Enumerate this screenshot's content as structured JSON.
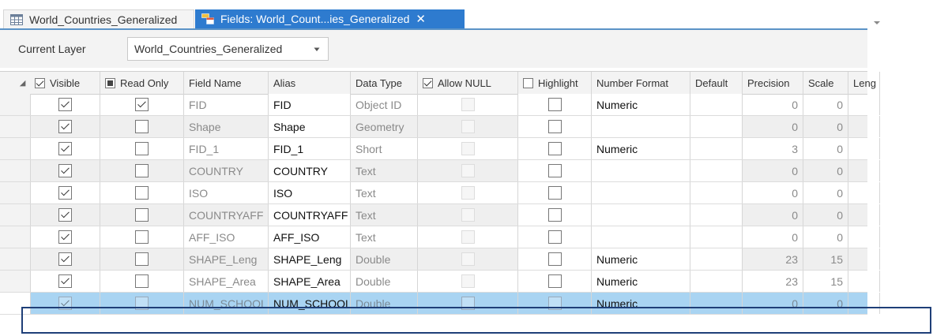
{
  "tabs": [
    {
      "label": "World_Countries_Generalized",
      "active": false
    },
    {
      "label": "Fields: World_Count...ies_Generalized",
      "active": true
    }
  ],
  "current_layer": {
    "label": "Current Layer",
    "value": "World_Countries_Generalized"
  },
  "columns": [
    {
      "key": "visible",
      "label": "Visible",
      "header_checkbox": "checked"
    },
    {
      "key": "read_only",
      "label": "Read Only",
      "header_checkbox": "filled"
    },
    {
      "key": "field_name",
      "label": "Field Name"
    },
    {
      "key": "alias",
      "label": "Alias"
    },
    {
      "key": "data_type",
      "label": "Data Type"
    },
    {
      "key": "allow_null",
      "label": "Allow NULL",
      "header_checkbox": "checked"
    },
    {
      "key": "highlight",
      "label": "Highlight",
      "header_checkbox": "unchecked"
    },
    {
      "key": "number_format",
      "label": "Number Format"
    },
    {
      "key": "default",
      "label": "Default"
    },
    {
      "key": "precision",
      "label": "Precision"
    },
    {
      "key": "scale",
      "label": "Scale"
    },
    {
      "key": "length",
      "label": "Leng"
    }
  ],
  "rows": [
    {
      "visible": true,
      "read_only": true,
      "field_name": "FID",
      "alias": "FID",
      "data_type": "Object ID",
      "allow_null": false,
      "highlight": false,
      "number_format": "Numeric",
      "default": "",
      "precision": "0",
      "scale": "0"
    },
    {
      "visible": true,
      "read_only": false,
      "field_name": "Shape",
      "alias": "Shape",
      "data_type": "Geometry",
      "allow_null": false,
      "highlight": false,
      "number_format": "",
      "default": "",
      "precision": "0",
      "scale": "0"
    },
    {
      "visible": true,
      "read_only": false,
      "field_name": "FID_1",
      "alias": "FID_1",
      "data_type": "Short",
      "allow_null": false,
      "highlight": false,
      "number_format": "Numeric",
      "default": "",
      "precision": "3",
      "scale": "0"
    },
    {
      "visible": true,
      "read_only": false,
      "field_name": "COUNTRY",
      "alias": "COUNTRY",
      "data_type": "Text",
      "allow_null": false,
      "highlight": false,
      "number_format": "",
      "default": "",
      "precision": "0",
      "scale": "0"
    },
    {
      "visible": true,
      "read_only": false,
      "field_name": "ISO",
      "alias": "ISO",
      "data_type": "Text",
      "allow_null": false,
      "highlight": false,
      "number_format": "",
      "default": "",
      "precision": "0",
      "scale": "0"
    },
    {
      "visible": true,
      "read_only": false,
      "field_name": "COUNTRYAFF",
      "alias": "COUNTRYAFF",
      "data_type": "Text",
      "allow_null": false,
      "highlight": false,
      "number_format": "",
      "default": "",
      "precision": "0",
      "scale": "0"
    },
    {
      "visible": true,
      "read_only": false,
      "field_name": "AFF_ISO",
      "alias": "AFF_ISO",
      "data_type": "Text",
      "allow_null": false,
      "highlight": false,
      "number_format": "",
      "default": "",
      "precision": "0",
      "scale": "0"
    },
    {
      "visible": true,
      "read_only": false,
      "field_name": "SHAPE_Leng",
      "alias": "SHAPE_Leng",
      "data_type": "Double",
      "allow_null": false,
      "highlight": false,
      "number_format": "Numeric",
      "default": "",
      "precision": "23",
      "scale": "15"
    },
    {
      "visible": true,
      "read_only": false,
      "field_name": "SHAPE_Area",
      "alias": "SHAPE_Area",
      "data_type": "Double",
      "allow_null": false,
      "highlight": false,
      "number_format": "Numeric",
      "default": "",
      "precision": "23",
      "scale": "15"
    },
    {
      "visible": true,
      "read_only": false,
      "field_name": "NUM_SCHOOL",
      "alias": "NUM_SCHOOL",
      "data_type": "Double",
      "allow_null": false,
      "highlight": false,
      "number_format": "Numeric",
      "default": "",
      "precision": "0",
      "scale": "0",
      "selected": true
    }
  ],
  "icons": {
    "table_tab": "table-icon",
    "fields_tab": "fields-view-icon",
    "close": "close-icon",
    "dropdown": "chevron-down-icon"
  },
  "colors": {
    "active_tab": "#2e7bcf",
    "selected_row": "#a9d4f2",
    "selection_outline": "#1f3f78"
  }
}
